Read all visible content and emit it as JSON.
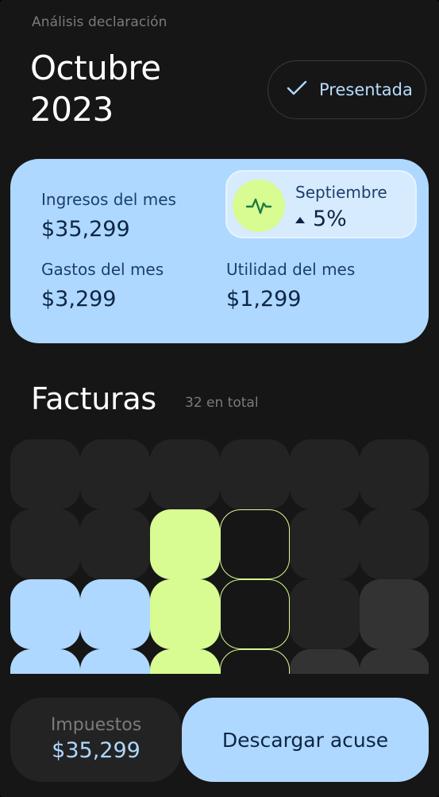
{
  "header": {
    "subtitle": "Análisis declaración",
    "title_month": "Octubre",
    "title_year": "2023",
    "status_label": "Presentada"
  },
  "summary": {
    "income_label": "Ingresos del mes",
    "income_value": "$35,299",
    "expenses_label": "Gastos del mes",
    "expenses_value": "$3,299",
    "profit_label": "Utilidad del mes",
    "profit_value": "$1,299",
    "comparison": {
      "month": "Septiembre",
      "change": "5%",
      "direction": "up",
      "icon": "activity-pulse-icon"
    }
  },
  "invoices": {
    "title": "Facturas",
    "count_label": "32 en total",
    "tile_states": [
      [
        "empty",
        "empty",
        "empty",
        "empty",
        "empty",
        "empty"
      ],
      [
        "empty",
        "empty",
        "lime",
        "outline",
        "empty",
        "empty"
      ],
      [
        "blue",
        "blue",
        "lime",
        "outline",
        "empty",
        "gray"
      ],
      [
        "blue",
        "blue",
        "lime",
        "outline",
        "gray",
        "gray"
      ]
    ]
  },
  "footer": {
    "tax_label": "Impuestos",
    "tax_value": "$35,299",
    "download_label": "Descargar acuse"
  },
  "colors": {
    "background": "#161616",
    "accent_blue": "#aed8ff",
    "accent_lime": "#d8fb92",
    "muted_text": "#7b7b7b"
  }
}
